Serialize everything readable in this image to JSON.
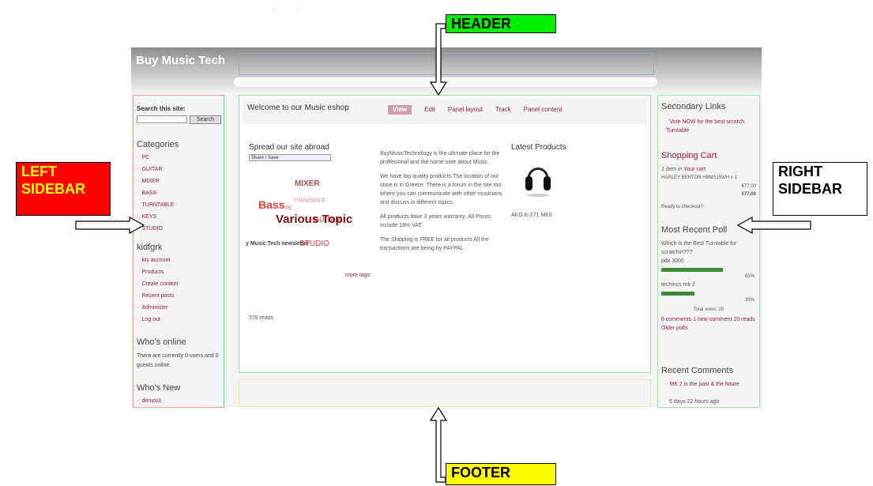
{
  "annotations": {
    "header": "HEADER",
    "footer": "FOOTER",
    "left_sidebar": [
      "LEFT",
      "SIDEBAR"
    ],
    "right_sidebar": [
      "RIGHT",
      "SIDEBAR"
    ],
    "colors": {
      "header": "#00ee00",
      "footer": "#ffff00",
      "left": "#ff0000",
      "left_text": "#ffff00"
    }
  },
  "site": {
    "title": "Buy Music Tech",
    "search": {
      "label": "Search this site:",
      "button": "Search"
    },
    "categories": {
      "title": "Categories",
      "items": [
        "PC",
        "GUITAR",
        "MIXER",
        "BASS",
        "TURNTABLE",
        "KEYS",
        "STUDIO"
      ]
    },
    "user_menu": {
      "title": "kidfgrk",
      "items": [
        "My account",
        "Products",
        "Create content",
        "Recent posts",
        "Administer",
        "Log out"
      ]
    },
    "whos_online": {
      "title": "Who's online",
      "text": "There are currently 0 users and 0 guests online."
    },
    "whos_new": {
      "title": "Who's New",
      "items": [
        "demos1"
      ]
    },
    "content": {
      "title": "Welcome to our Music eshop",
      "tabs": [
        "View",
        "Edit",
        "Panel layout",
        "Track",
        "Panel content"
      ],
      "spread_title": "Spread our site abroad",
      "share_label": "Share / Save",
      "tags": {
        "mixer": "MIXER",
        "bass": "Bass",
        "pc": "PC",
        "turntable": "TURNTABLE",
        "various": "Various Topic",
        "guitar": "GUITAR",
        "studio": "STUDIO"
      },
      "newsletter": "y Music Tech newsletter",
      "more_tags": "more tags",
      "reads": "579 reads",
      "paragraphs": [
        "BuyMusicTechnology is the ultimate place for the proffesional and the home user about Music .",
        "We have top quality products.The location of our store is in Greece. There is a forum in the site too where you can communicate with other musicians and discuss in different topics.",
        "All products have 3 years warranty .All Prices include 19% VAT.",
        "The Shipping is FREE for all products All the transactions are being by PAYPAL"
      ],
      "latest_title": "Latest Products",
      "product_name": "AKG K-271 MKII"
    },
    "right": {
      "secondary_title": "Secondary Links",
      "secondary_link": "Vote NOW for the best scratch Turntable",
      "cart_title": "Shopping Cart",
      "cart_items_prefix": "1 item in",
      "cart_link": "Your cart",
      "cart_product": "HARLEY BENTON HBMS15WH x 1",
      "cart_price": "€77,00",
      "cart_total": "€77,00",
      "checkout": "Ready to checkout?",
      "poll_title": "Most Recent Poll",
      "poll_question": "Which is the Best Turntable for scratchin???",
      "poll_options": [
        {
          "label": "pdx 3000",
          "percent": 65,
          "percent_label": "65%"
        },
        {
          "label": "techincs mk 2",
          "percent": 35,
          "percent_label": "35%"
        }
      ],
      "total_votes": "Total votes: 20",
      "poll_links": "6 comments   1 new comment   20 reads   Older polls",
      "recent_comments_title": "Recent Comments",
      "comment": "MK 2 is the past & the future",
      "comment_time": "5 days 22 hours ago"
    }
  }
}
